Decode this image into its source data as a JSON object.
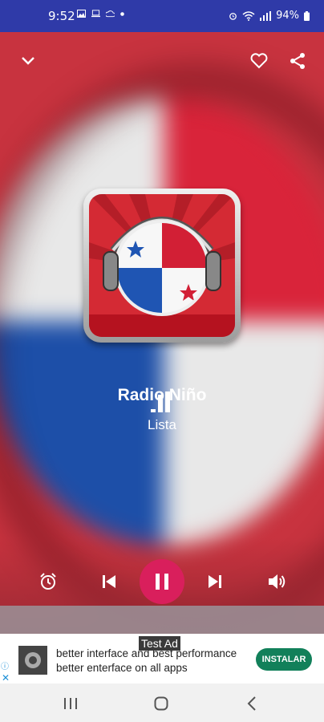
{
  "status_bar": {
    "time": "9:52",
    "battery": "94%",
    "icons": [
      "gallery-icon",
      "laptop-icon",
      "cloud-icon",
      "dot-icon",
      "alarm-icon",
      "wifi-icon",
      "signal-icon",
      "battery-icon"
    ]
  },
  "top_bar": {
    "icons": [
      "chevron-down-icon",
      "heart-icon",
      "share-icon"
    ]
  },
  "now_playing": {
    "station_name": "Radio Niño",
    "subtitle": "Lista"
  },
  "controls": {
    "icons": [
      "alarm-clock-icon",
      "skip-previous-icon",
      "pause-icon",
      "skip-next-icon",
      "volume-icon"
    ],
    "play_button_color": "#d91f5c"
  },
  "ad": {
    "label": "Test Ad",
    "line1": "better interface and best performance",
    "line2": "better enterface on all apps",
    "button": "INSTALAR",
    "button_color": "#12805a"
  },
  "nav_bar": {
    "icons": [
      "recent-apps-icon",
      "home-icon",
      "back-icon"
    ]
  },
  "colors": {
    "status_bar": "#2f3aa8",
    "flag_red": "#d9243a",
    "flag_blue": "#1d4fa8"
  }
}
